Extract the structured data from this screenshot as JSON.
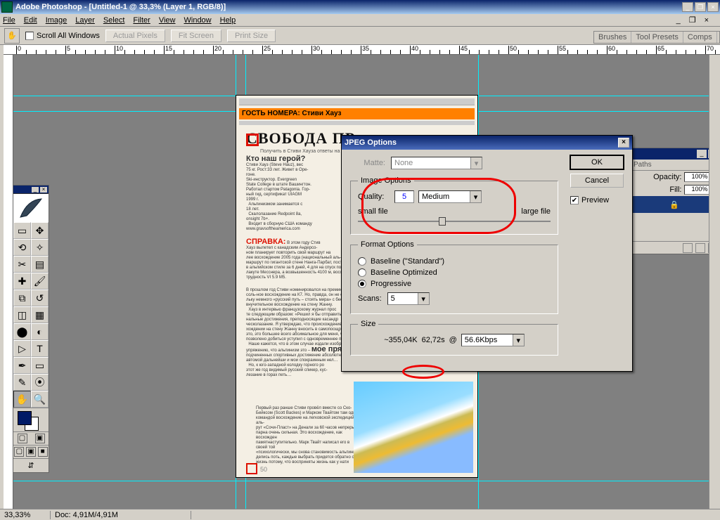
{
  "window": {
    "title": "Adobe Photoshop - [Untitled-1 @ 33,3% (Layer 1, RGB/8)]"
  },
  "menu": [
    "File",
    "Edit",
    "Image",
    "Layer",
    "Select",
    "Filter",
    "View",
    "Window",
    "Help"
  ],
  "options": {
    "scroll_all": "Scroll All Windows",
    "actual": "Actual Pixels",
    "fit": "Fit Screen",
    "print": "Print Size"
  },
  "ruler_labels": [
    "0",
    "5",
    "10",
    "15",
    "20",
    "25",
    "30",
    "35",
    "40",
    "45",
    "50",
    "55",
    "60",
    "65",
    "70"
  ],
  "palettes_tabs": [
    "Brushes",
    "Tool Presets",
    "Comps"
  ],
  "layers": {
    "tab": "Paths",
    "opacity_label": "Opacity:",
    "opacity_val": "100%",
    "fill_label": "Fill:",
    "fill_val": "100%"
  },
  "doc": {
    "orange": "ГОСТЬ НОМЕРА: Стиви Хауз",
    "headline": "СВОБОДА ПР",
    "sub": "Получить в Стиви Хауза ответы на вопросы ...",
    "sec_hd": "Кто наш герой?",
    "spravka": "СПРАВКА:",
    "morebold": "мое прямое представление",
    "corner_num": "50"
  },
  "dialog": {
    "title": "JPEG Options",
    "ok": "OK",
    "cancel": "Cancel",
    "preview": "Preview",
    "matte_label": "Matte:",
    "matte_value": "None",
    "image_options": "Image Options",
    "quality_label": "Quality:",
    "quality_value": "5",
    "quality_drop": "Medium",
    "small_file": "small file",
    "large_file": "large file",
    "format_options": "Format Options",
    "r1": "Baseline (\"Standard\")",
    "r2": "Baseline Optimized",
    "r3": "Progressive",
    "scans_label": "Scans:",
    "scans_value": "5",
    "size": "Size",
    "size_val": "~355,04K",
    "size_time": "62,72s",
    "at": "@",
    "kbps": "56.6Kbps"
  },
  "status": {
    "zoom": "33,33%",
    "doc": "Doc: 4,91M/4,91M"
  }
}
